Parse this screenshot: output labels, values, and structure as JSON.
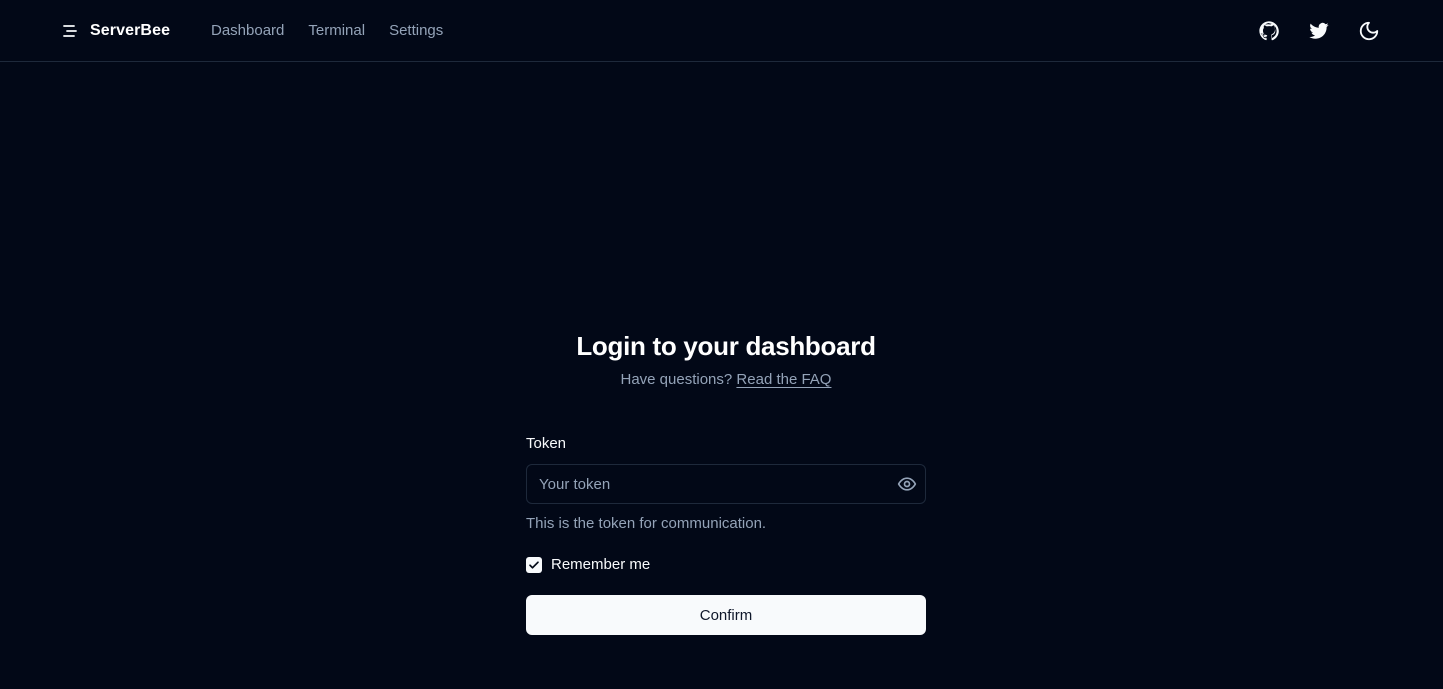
{
  "header": {
    "brand": "ServerBee",
    "nav": [
      {
        "label": "Dashboard"
      },
      {
        "label": "Terminal"
      },
      {
        "label": "Settings"
      }
    ],
    "actions": {
      "github_icon": "github-icon",
      "twitter_icon": "twitter-icon",
      "theme_icon": "moon-icon"
    }
  },
  "login": {
    "title": "Login to your dashboard",
    "subtitle_prefix": "Have questions?",
    "faq_link": "Read the FAQ",
    "token_label": "Token",
    "token_value": "",
    "token_placeholder": "Your token",
    "token_helper": "This is the token for communication.",
    "remember_label": "Remember me",
    "remember_checked": true,
    "confirm_label": "Confirm"
  },
  "colors": {
    "background": "#020817",
    "border": "#1e293b",
    "muted_text": "#94a3b8",
    "foreground": "#f8fafc"
  }
}
